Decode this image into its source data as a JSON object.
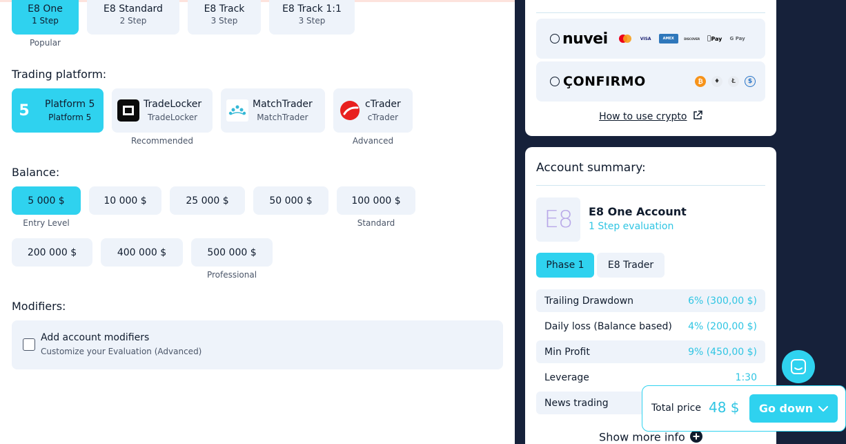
{
  "evaluation_types": [
    {
      "label": "E8 One",
      "sub": "1 Step",
      "selected": true
    },
    {
      "label": "E8 Standard",
      "sub": "2 Step",
      "selected": false
    },
    {
      "label": "E8 Track",
      "sub": "3 Step",
      "selected": false
    },
    {
      "label": "E8 Track 1:1",
      "sub": "3 Step",
      "selected": false
    }
  ],
  "evaluation_hint": "Popular",
  "trading_platform": {
    "heading": "Trading platform:",
    "options": [
      {
        "name": "Platform 5",
        "sub": "Platform 5",
        "logo_text": "5",
        "icon": "platform5-icon"
      },
      {
        "name": "TradeLocker",
        "sub": "TradeLocker",
        "icon": "tradelocker-icon"
      },
      {
        "name": "MatchTrader",
        "sub": "MatchTrader",
        "icon": "matchtrader-icon"
      },
      {
        "name": "cTrader",
        "sub": "cTrader",
        "icon": "ctrader-icon"
      }
    ],
    "hints": [
      "Recommended",
      "Advanced"
    ]
  },
  "balance": {
    "heading": "Balance:",
    "options": [
      "5 000 $",
      "10 000 $",
      "25 000 $",
      "50 000 $",
      "100 000 $",
      "200 000 $",
      "400 000 $",
      "500 000 $"
    ],
    "hints": [
      "Entry Level",
      "Standard",
      "Professional"
    ]
  },
  "modifiers": {
    "heading": "Modifiers:",
    "title": "Add account modifiers",
    "subtitle": "Customize your Evaluation (Advanced)"
  },
  "payment": {
    "providers": [
      {
        "name": "nuvei",
        "badges": [
          "MC",
          "VISA",
          "AMEX",
          "DISCOVER",
          "Pay",
          "G Pay"
        ]
      },
      {
        "name": "ÇONFIRMO",
        "coins": [
          "₿",
          "♦",
          "Ł",
          "$"
        ]
      }
    ],
    "crypto_link": "How to use crypto"
  },
  "summary": {
    "heading": "Account summary:",
    "account_logo": "E8",
    "account_name": "E8 One Account",
    "account_sub": "1 Step evaluation",
    "tabs": [
      "Phase 1",
      "E8 Trader"
    ],
    "rows": [
      {
        "label": "Trailing Drawdown",
        "value": "6% (300,00 $)"
      },
      {
        "label": "Daily loss (Balance based)",
        "value": "4% (200,00 $)"
      },
      {
        "label": "Min Profit",
        "value": "9% (450,00 $)"
      },
      {
        "label": "Leverage",
        "value": "1:30"
      },
      {
        "label": "News trading",
        "value": ""
      }
    ],
    "show_more": "Show more info"
  },
  "total": {
    "label": "Total price",
    "price": "48 $",
    "button": "Go down"
  },
  "colors": {
    "accent": "#2fd2ef",
    "dark_bg": "#16213a",
    "option_bg": "#eef3fa"
  }
}
